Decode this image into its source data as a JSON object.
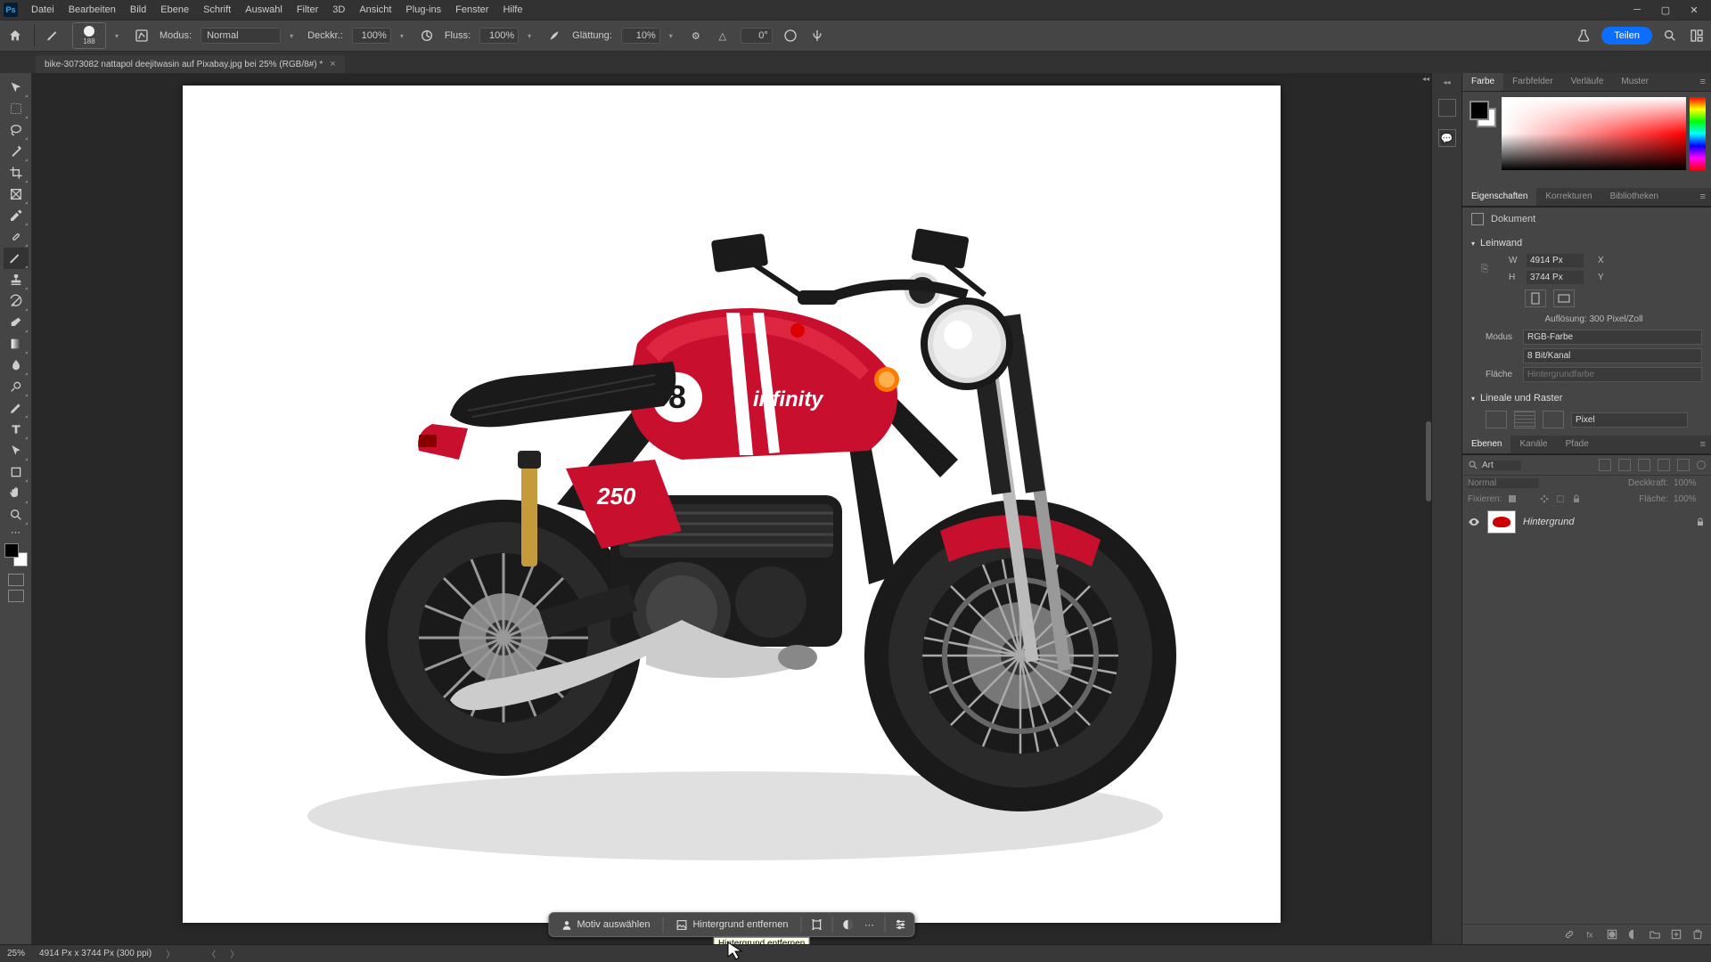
{
  "menu": [
    "Datei",
    "Bearbeiten",
    "Bild",
    "Ebene",
    "Schrift",
    "Auswahl",
    "Filter",
    "3D",
    "Ansicht",
    "Plug-ins",
    "Fenster",
    "Hilfe"
  ],
  "options": {
    "brush_size": "188",
    "mode_label": "Modus:",
    "mode_value": "Normal",
    "opacity_label": "Deckkr.:",
    "opacity_value": "100%",
    "flow_label": "Fluss:",
    "flow_value": "100%",
    "smoothing_label": "Glättung:",
    "smoothing_value": "10%",
    "angle_value": "0°",
    "share": "Teilen"
  },
  "document": {
    "tab_title": "bike-3073082 nattapol deejitwasin auf Pixabay.jpg bei 25% (RGB/8#) *"
  },
  "quickbar": {
    "select_subject": "Motiv auswählen",
    "remove_bg": "Hintergrund entfernen",
    "tooltip": "Hintergrund entfernen"
  },
  "panels": {
    "color_tabs": [
      "Farbe",
      "Farbfelder",
      "Verläufe",
      "Muster"
    ],
    "props_tabs": [
      "Eigenschaften",
      "Korrekturen",
      "Bibliotheken"
    ],
    "props_doc": "Dokument",
    "canvas_section": "Leinwand",
    "W_label": "W",
    "W_val": "4914 Px",
    "H_label": "H",
    "H_val": "3744 Px",
    "X_label": "X",
    "Y_label": "Y",
    "resolution": "Auflösung: 300 Pixel/Zoll",
    "mode_label": "Modus",
    "mode_val": "RGB-Farbe",
    "depth_val": "8 Bit/Kanal",
    "fill_label": "Fläche",
    "fill_val": "Hintergrundfarbe",
    "ruler_section": "Lineale und Raster",
    "ruler_unit": "Pixel",
    "layers_tabs": [
      "Ebenen",
      "Kanäle",
      "Pfade"
    ],
    "layers_filter_kind": "Art",
    "blend_mode": "Normal",
    "opacity_label": "Deckkraft:",
    "opacity_val": "100%",
    "lock_label": "Fixieren:",
    "fill_opacity_label": "Fläche:",
    "fill_opacity_val": "100%",
    "layer_bg_name": "Hintergrund"
  },
  "status": {
    "zoom": "25%",
    "dims": "4914 Px x 3744 Px (300 ppi)"
  }
}
